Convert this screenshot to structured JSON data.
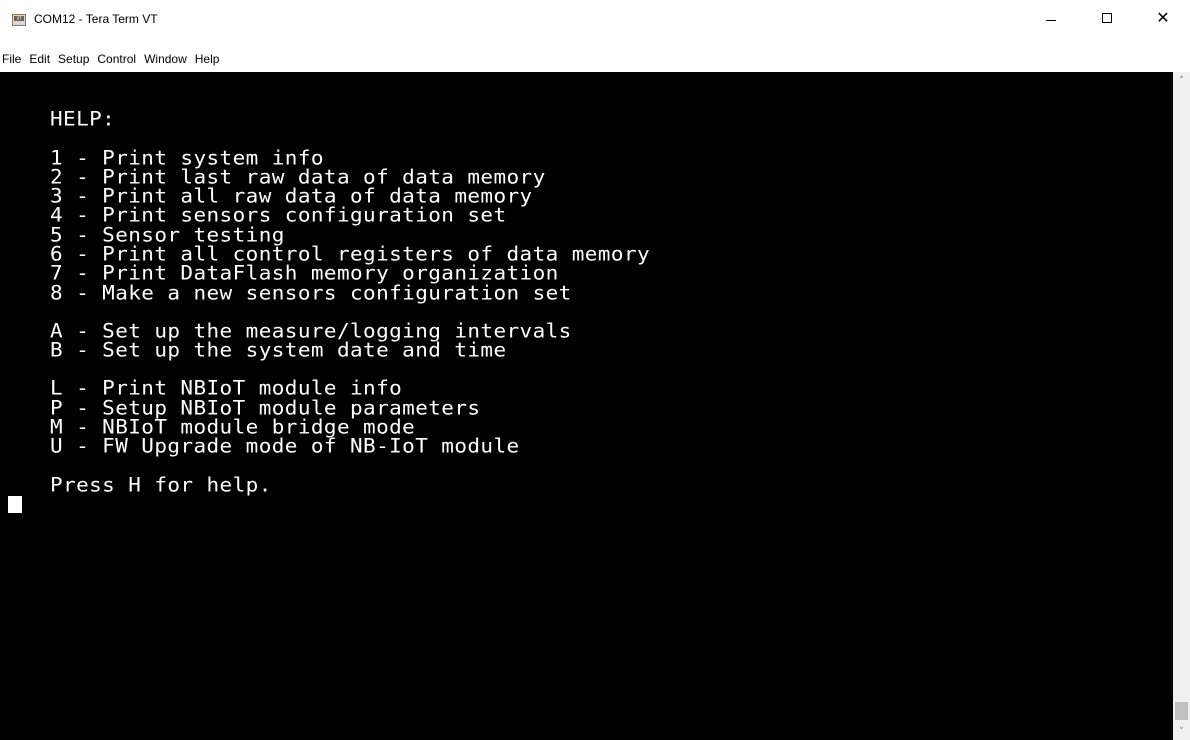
{
  "window": {
    "title": "COM12 - Tera Term VT",
    "icon": "teraterm-vt-icon",
    "icon_text": "VT",
    "controls": {
      "minimize_glyph": "—",
      "maximize_glyph": "☐",
      "close_glyph": "✕"
    }
  },
  "menubar": {
    "items": [
      {
        "label": "File"
      },
      {
        "label": "Edit"
      },
      {
        "label": "Setup"
      },
      {
        "label": "Control"
      },
      {
        "label": "Window"
      },
      {
        "label": "Help"
      }
    ]
  },
  "terminal": {
    "lines": [
      "HELP:",
      "1 - Print system info",
      "2 - Print last raw data of data memory",
      "3 - Print all raw data of data memory",
      "4 - Print sensors configuration set",
      "5 - Sensor testing",
      "6 - Print all control registers of data memory",
      "7 - Print DataFlash memory organization",
      "8 - Make a new sensors configuration set",
      "A - Set up the measure/logging intervals",
      "B - Set up the system date and time",
      "L - Print NBIoT module info",
      "P - Setup NBIoT module parameters",
      "M - NBIoT module bridge mode",
      "U - FW Upgrade mode of NB-IoT module",
      "Press H for help."
    ],
    "foreground": "#ffffff",
    "background": "#000000"
  },
  "scrollbar": {
    "up_arrow": "˄",
    "down_arrow": "˅"
  }
}
